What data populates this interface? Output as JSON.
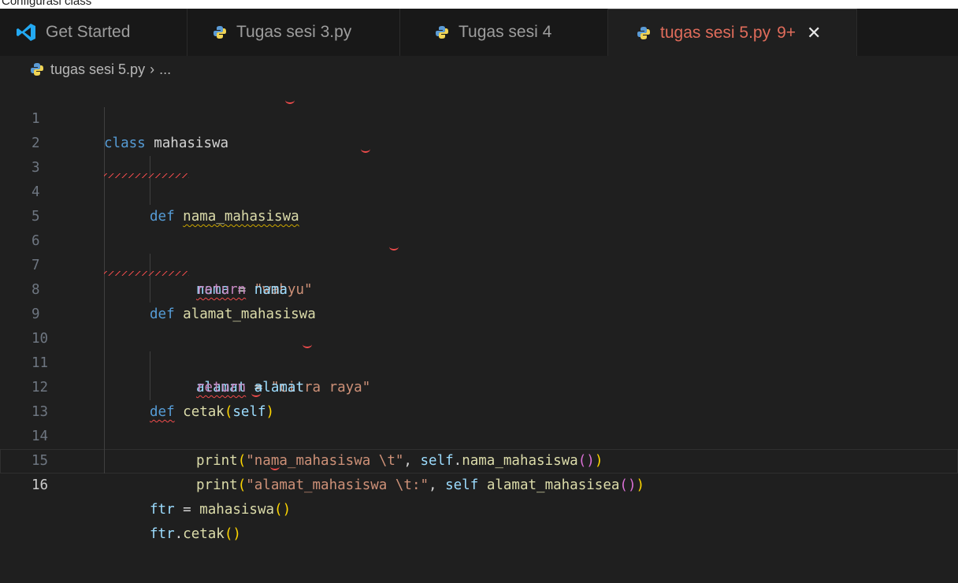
{
  "caption": "Configurasi class",
  "tabs": [
    {
      "label": "Get Started",
      "icon": "vscode-icon",
      "active": false
    },
    {
      "label": "Tugas sesi 3.py",
      "icon": "python-file-icon",
      "active": false
    },
    {
      "label": "Tugas sesi 4",
      "icon": "python-file-icon",
      "active": false
    },
    {
      "label": "tugas sesi 5.py",
      "badge": "9+",
      "close": "✕",
      "icon": "python-file-icon",
      "active": true
    }
  ],
  "breadcrumb": {
    "file": "tugas sesi 5.py",
    "separator": "›",
    "rest": "..."
  },
  "lines": [
    {
      "n": "1"
    },
    {
      "n": "2"
    },
    {
      "n": "3"
    },
    {
      "n": "4"
    },
    {
      "n": "5"
    },
    {
      "n": "6"
    },
    {
      "n": "7"
    },
    {
      "n": "8"
    },
    {
      "n": "9"
    },
    {
      "n": "10"
    },
    {
      "n": "11"
    },
    {
      "n": "12"
    },
    {
      "n": "13"
    },
    {
      "n": "14"
    },
    {
      "n": "15"
    },
    {
      "n": "16"
    }
  ],
  "tokens": {
    "class": "class",
    "mahasiswa": "mahasiswa",
    "def": "def",
    "nama_mahasiswa": "nama_mahasiswa",
    "nama": "nama",
    "eq": " = ",
    "wahyu": "\"wahyu\"",
    "return": "return",
    "alamat_mahasiswa": "alamat_mahasiswa",
    "alamat": "alamat",
    "citra": "\"citra raya\"",
    "cetak": "cetak",
    "self": "self",
    "print": "print",
    "s12": "\"nama_mahasiswa \\t\"",
    "s13": "\"alamat_mahasiswa \\t:\"",
    "alamat_mahasisea": "alamat_mahasisea",
    "ftr": "ftr",
    "dot": ".",
    "comma": ", ",
    "space": " ",
    "lp": "(",
    "rp": ")"
  },
  "colors": {
    "accent_active_tab": "#e06c5b",
    "error": "#f14c4c",
    "warning": "#cca700"
  }
}
